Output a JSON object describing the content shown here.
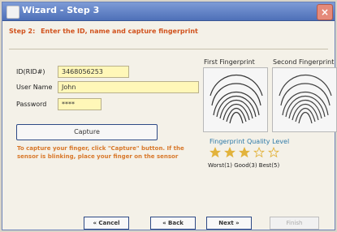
{
  "window": {
    "title": "Wizard - Step 3",
    "close_glyph": "×"
  },
  "step": {
    "label": "Step 2:",
    "text": "Enter the ID, name and capture fingerprint"
  },
  "form": {
    "id_label": "ID(RID#)",
    "id_value": "3468056253",
    "username_label": "User Name",
    "username_value": "John",
    "password_label": "Password",
    "password_value": "****"
  },
  "capture_button": "Capture",
  "hint": "To capture your finger, click \"Capture\" button. If the sensor is blinking, place your finger on the sensor",
  "fingerprints": {
    "first_title": "First Fingerprint",
    "second_title": "Second Fingerprint"
  },
  "quality": {
    "title": "Fingerprint Quality Level",
    "rating_filled": 3,
    "rating_max": 5,
    "labels": "Worst(1) Good(3) Best(5)"
  },
  "buttons": {
    "cancel": "« Cancel",
    "back": "« Back",
    "next": "Next »",
    "finish": "Finish"
  },
  "colors": {
    "accent_orange": "#d8782a",
    "step_red": "#d1521d",
    "input_yellow": "#fff7b8",
    "star_gold": "#e2b33c"
  }
}
